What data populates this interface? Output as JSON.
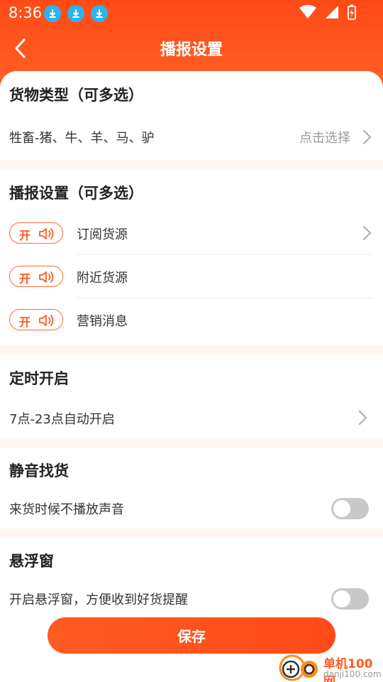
{
  "status_bar": {
    "time": "8:36",
    "download_icons": 3
  },
  "header": {
    "title": "播报设置"
  },
  "cargo_type": {
    "title": "货物类型（可多选）",
    "value": "牲畜-猪、牛、羊、马、驴",
    "hint": "点击选择"
  },
  "broadcast": {
    "title": "播报设置（可多选）",
    "items": [
      {
        "toggle": "开",
        "label": "订阅货源",
        "has_arrow": true
      },
      {
        "toggle": "开",
        "label": "附近货源",
        "has_arrow": false
      },
      {
        "toggle": "开",
        "label": "营销消息",
        "has_arrow": false
      }
    ]
  },
  "timer": {
    "title": "定时开启",
    "value": "7点-23点自动开启"
  },
  "silent": {
    "title": "静音找货",
    "label": "来货时候不播放声音",
    "enabled": false
  },
  "floating": {
    "title": "悬浮窗",
    "label": "开启悬浮窗，方便收到好货提醒",
    "enabled": false
  },
  "save": {
    "label": "保存"
  },
  "watermark": {
    "title": "单机100网",
    "url": "danji100.com"
  },
  "colors": {
    "accent": "#ff4a17",
    "switch_off": "#c8c8c8",
    "download_badge": "#2bb4f0"
  }
}
